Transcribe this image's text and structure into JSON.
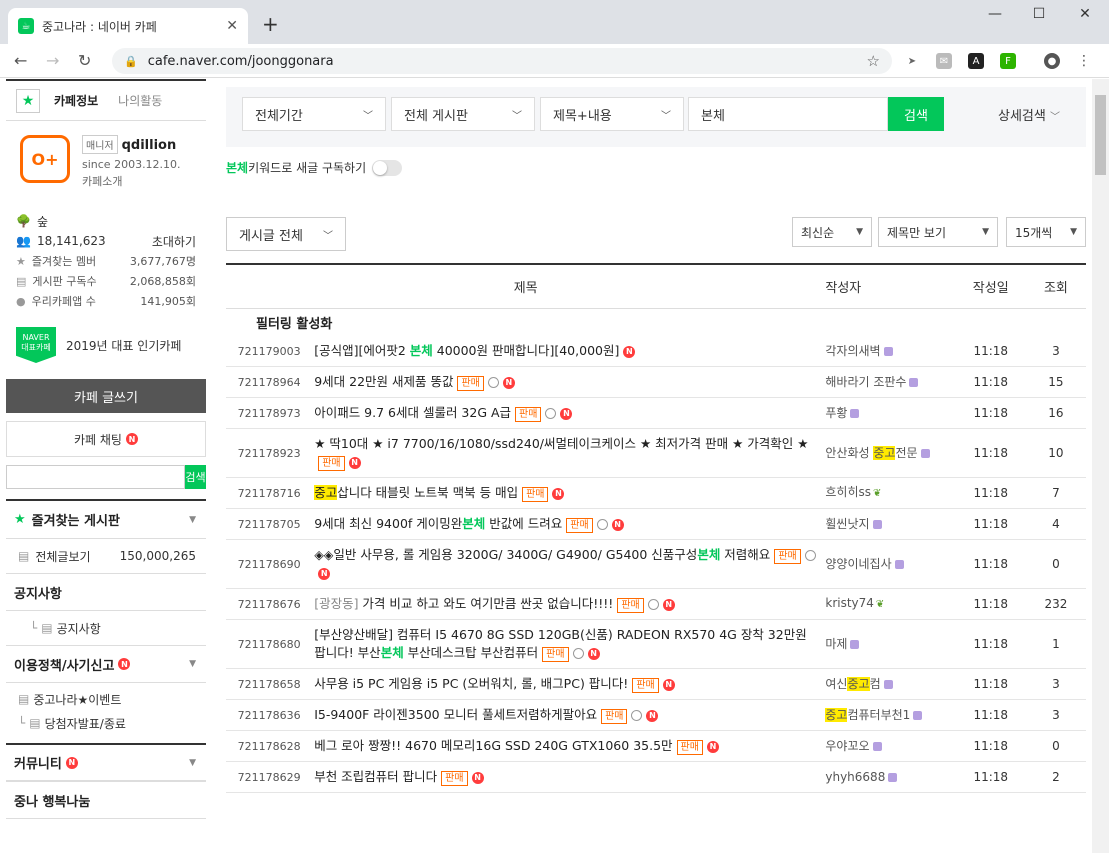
{
  "browser": {
    "tab_title": "중고나라 : 네이버 카페",
    "url": "cafe.naver.com/joonggonara"
  },
  "sidebar": {
    "tab_info": "카페정보",
    "tab_activity": "나의활동",
    "manager_badge": "매니저",
    "manager_id": "qdillion",
    "since": "since 2003.12.10.",
    "intro": "카페소개",
    "level": "숲",
    "members": "18,141,623",
    "invite": "초대하기",
    "stats": [
      {
        "label": "즐겨찾는 멤버",
        "value": "3,677,767명"
      },
      {
        "label": "게시판 구독수",
        "value": "2,068,858회"
      },
      {
        "label": "우리카페앱 수",
        "value": "141,905회"
      }
    ],
    "naver_badge_1": "NAVER",
    "naver_badge_2": "대표카페",
    "naver_text": "2019년 대표 인기카페",
    "write_btn": "카페 글쓰기",
    "chat_btn": "카페 채팅",
    "search_btn": "검색",
    "fav_title": "즐겨찾는 게시판",
    "all_posts": "전체글보기",
    "all_posts_count": "150,000,265",
    "notice_head": "공지사항",
    "notice_item": "공지사항",
    "policy_head": "이용정책/사기신고",
    "event_item": "중고나라★이벤트",
    "winner_item": "당첨자발표/종료",
    "community_head": "커뮤니티",
    "share_head": "중나 행복나눔"
  },
  "filters": {
    "period": "전체기간",
    "board": "전체 게시판",
    "scope": "제목+내용",
    "keyword": "본체",
    "search_btn": "검색",
    "detail": "상세검색"
  },
  "subscribe": {
    "keyword": "본체",
    "text": " 키워드로 새글 구독하기"
  },
  "list_controls": {
    "category": "게시글 전체",
    "sort": "최신순",
    "view": "제목만 보기",
    "count": "15개씩"
  },
  "table": {
    "headers": {
      "title": "제목",
      "author": "작성자",
      "date": "작성일",
      "views": "조회"
    },
    "filtering": "필터링 활성화",
    "rows": [
      {
        "num": "721179003",
        "pre": "[공식앱][에어팟2 ",
        "kw": "본체",
        "post": " 40000원 판매합니다][40,000원]",
        "tag": "",
        "cam": false,
        "author": "각자의새벽",
        "date": "11:18",
        "views": "3"
      },
      {
        "num": "721178964",
        "pre": "9세대 22만원 새제품 똥값",
        "kw": "",
        "post": "",
        "tag": "판매",
        "cam": true,
        "author": "해바라기 조판수",
        "date": "11:18",
        "views": "15"
      },
      {
        "num": "721178973",
        "pre": "아이패드 9.7 6세대 셀룰러 32G A급",
        "kw": "",
        "post": "",
        "tag": "판매",
        "cam": true,
        "author": "푸황",
        "date": "11:18",
        "views": "16"
      },
      {
        "num": "721178923",
        "pre": "★ 딱10대 ★ i7 7700/16/1080/ssd240/써멀테이크케이스 ★ 최저가격 판매 ★ 가격확인 ★",
        "kw": "",
        "post": "",
        "tag": "판매",
        "cam": false,
        "author_pre": "안산화성 ",
        "author_hl": "중고",
        "author_post": "전문",
        "date": "11:18",
        "views": "10"
      },
      {
        "num": "721178716",
        "hl": "중고",
        "pre": "삽니다 태블릿 노트북 맥북 등 매입",
        "kw": "",
        "post": "",
        "tag": "판매",
        "cam": false,
        "author": "흐히히ss",
        "date": "11:18",
        "views": "7"
      },
      {
        "num": "721178705",
        "pre": "9세대 최신 9400f 게이밍완",
        "kw": "본체",
        "post": " 반값에 드려요",
        "tag": "판매",
        "cam": true,
        "author": "휠씬낫지",
        "date": "11:18",
        "views": "4"
      },
      {
        "num": "721178690",
        "pre": "◈◈일반 사무용, 롤 게임용 3200G/ 3400G/ G4900/ G5400 신품구성",
        "kw": "본체",
        "post": " 저렴해요",
        "tag": "판매",
        "cam": true,
        "author": "양양이네집사",
        "date": "11:18",
        "views": "0"
      },
      {
        "num": "721178676",
        "gpre": "[광장동]",
        "pre": " 가격 비교 하고 와도 여기만큼 싼곳 없습니다!!!!",
        "kw": "",
        "post": "",
        "tag": "판매",
        "cam": true,
        "author": "kristy74",
        "date": "11:18",
        "views": "232"
      },
      {
        "num": "721178680",
        "pre": "[부산양산배달] 컴퓨터 I5 4670 8G SSD 120GB(신품) RADEON RX570 4G 장착 32만원 팝니다! 부산",
        "kw": "본체",
        "post": " 부산데스크탑 부산컴퓨터",
        "tag": "판매",
        "cam": true,
        "author": "마제",
        "date": "11:18",
        "views": "1"
      },
      {
        "num": "721178658",
        "pre": "사무용 i5 PC 게임용 i5 PC (오버워치, 롤, 배그PC) 팝니다!",
        "kw": "",
        "post": "",
        "tag": "판매",
        "cam": false,
        "author_pre": "여신",
        "author_hl": "중고",
        "author_post": "컴",
        "date": "11:18",
        "views": "3"
      },
      {
        "num": "721178636",
        "pre": "I5-9400F 라이젠3500 모니터 풀세트저렴하게팔아요",
        "kw": "",
        "post": "",
        "tag": "판매",
        "cam": true,
        "author_pre": "",
        "author_hl": "중고",
        "author_post": "컴퓨터부천1",
        "date": "11:18",
        "views": "3"
      },
      {
        "num": "721178628",
        "pre": "베그 로아 짱짱!! 4670 메모리16G SSD 240G GTX1060 35.5만",
        "kw": "",
        "post": "",
        "tag": "판매",
        "cam": false,
        "author": "우야꼬오",
        "date": "11:18",
        "views": "0"
      },
      {
        "num": "721178629",
        "pre": "부천 조립컴퓨터 팝니다",
        "kw": "",
        "post": "",
        "tag": "판매",
        "cam": false,
        "author": "yhyh6688",
        "date": "11:18",
        "views": "2"
      }
    ]
  }
}
